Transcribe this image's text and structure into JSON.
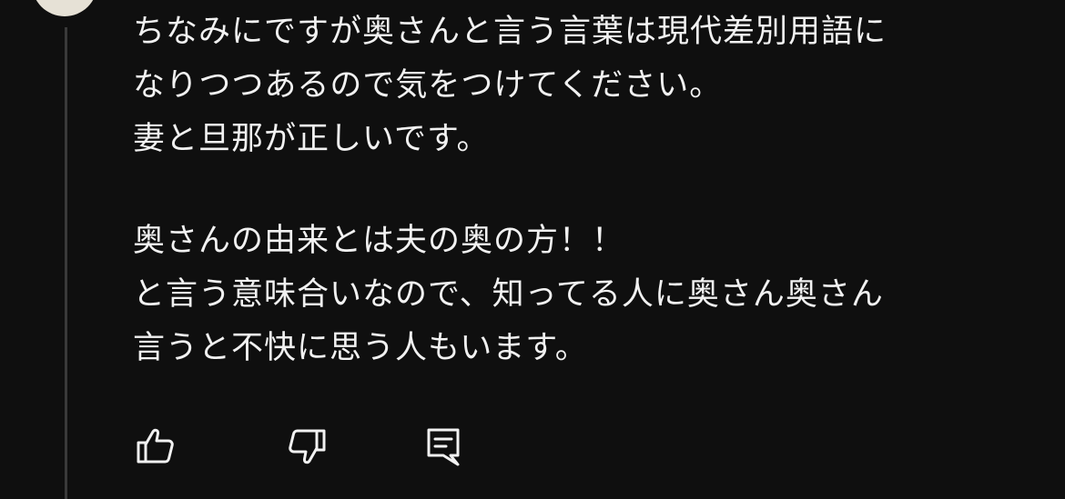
{
  "comment": {
    "lines": [
      "ちなみにですが奥さんと言う言葉は現代差別用語に",
      "なりつつあるので気をつけてください。",
      "妻と旦那が正しいです。",
      "",
      "奥さんの由来とは夫の奥の方！！",
      "と言う意味合いなので、知ってる人に奥さん奥さん",
      "言うと不快に思う人もいます。"
    ]
  },
  "actions": {
    "like_icon": "thumbs-up-icon",
    "dislike_icon": "thumbs-down-icon",
    "reply_icon": "comment-icon"
  },
  "colors": {
    "background": "#0f0f0f",
    "text": "#f1f1f1",
    "thread_line": "#3a3a3a",
    "avatar": "#e6e1d6"
  }
}
